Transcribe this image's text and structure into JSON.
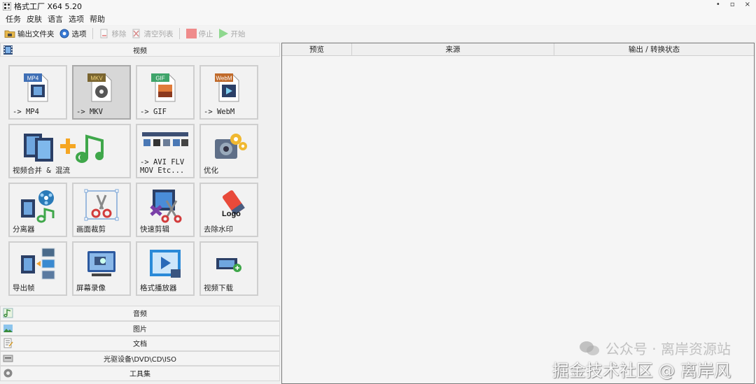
{
  "window": {
    "title": "格式工厂 X64 5.20",
    "controls": [
      "•",
      "▫",
      "×"
    ]
  },
  "menu": [
    "任务",
    "皮肤",
    "语言",
    "选项",
    "帮助"
  ],
  "toolbar": {
    "output_folder": "输出文件夹",
    "options": "选项",
    "remove": "移除",
    "clear_list": "清空列表",
    "stop": "停止",
    "start": "开始"
  },
  "categories": {
    "video": "视频",
    "audio": "音频",
    "image": "图片",
    "document": "文档",
    "rom": "光驱设备\\DVD\\CD\\ISO",
    "tools": "工具集"
  },
  "video_tiles": [
    {
      "label": "-> MP4",
      "badge": "MP4"
    },
    {
      "label": "-> MKV",
      "badge": "MKV"
    },
    {
      "label": "-> GIF",
      "badge": "GIF"
    },
    {
      "label": "-> WebM",
      "badge": "WebM"
    },
    {
      "label": "视频合并 & 混流"
    },
    {
      "label": "-> AVI FLV\nMOV Etc..."
    },
    {
      "label": "优化"
    },
    {
      "label": "分离器"
    },
    {
      "label": "画面裁剪"
    },
    {
      "label": "快速剪辑"
    },
    {
      "label": "去除水印",
      "badge": "Logo"
    },
    {
      "label": "导出帧"
    },
    {
      "label": "屏幕录像"
    },
    {
      "label": "格式播放器"
    },
    {
      "label": "视频下载"
    }
  ],
  "task_table": {
    "columns": [
      "预览",
      "来源",
      "输出 / 转换状态"
    ]
  },
  "watermark": {
    "line1": "公众号 · 离岸资源站",
    "line2": "掘金技术社区 @ 离岸风"
  },
  "colors": {
    "accent_blue": "#2f6fc0",
    "selected_tile": "#d7d7d7",
    "stop_red": "#e56a6a",
    "start_green": "#6cc46c"
  }
}
